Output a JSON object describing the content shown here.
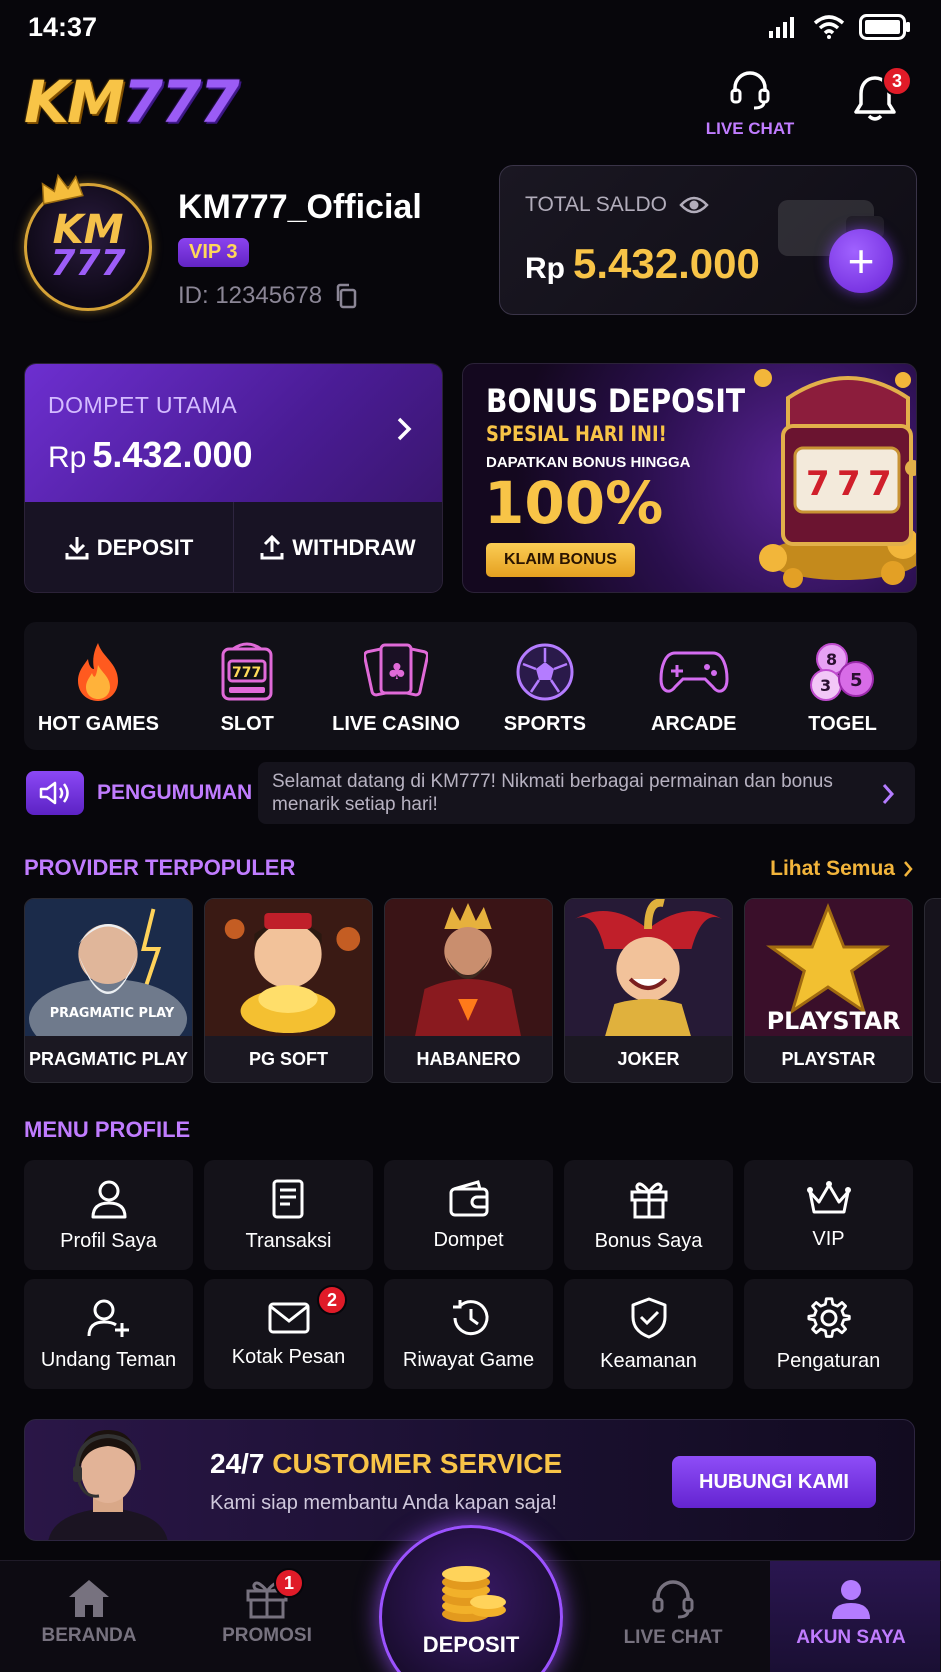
{
  "status_bar": {
    "time": "14:37"
  },
  "header": {
    "logo_km": "KM",
    "logo_num": "777",
    "live_chat_label": "LIVE CHAT",
    "notification_count": "3"
  },
  "profile": {
    "avatar_text_top": "KM",
    "avatar_text_bottom": "777",
    "username": "KM777_Official",
    "vip": "VIP 3",
    "id_text": "ID: 12345678"
  },
  "saldo": {
    "label": "TOTAL SALDO",
    "currency": "Rp",
    "amount": "5.432.000",
    "add_label": "+"
  },
  "wallet": {
    "title": "DOMPET UTAMA",
    "currency": "Rp",
    "amount": "5.432.000",
    "deposit_label": "DEPOSIT",
    "withdraw_label": "WITHDRAW"
  },
  "bonus_banner": {
    "title": "BONUS DEPOSIT",
    "subtitle": "SPESIAL HARI INI!",
    "caption": "DAPATKAN BONUS HINGGA",
    "percent": "100%",
    "button": "KLAIM BONUS"
  },
  "categories": [
    {
      "label": "HOT GAMES",
      "icon": "fire-icon"
    },
    {
      "label": "SLOT",
      "icon": "slot-machine-icon"
    },
    {
      "label": "LIVE CASINO",
      "icon": "cards-icon"
    },
    {
      "label": "SPORTS",
      "icon": "soccer-ball-icon"
    },
    {
      "label": "ARCADE",
      "icon": "gamepad-icon"
    },
    {
      "label": "TOGEL",
      "icon": "lottery-balls-icon"
    }
  ],
  "lottery_balls": [
    "8",
    "3",
    "5"
  ],
  "announcement": {
    "title": "PENGUMUMAN",
    "text": "Selamat datang di KM777! Nikmati berbagai permainan dan bonus menarik setiap hari!"
  },
  "providers_section": {
    "title": "PROVIDER TERPOPULER",
    "see_all": "Lihat Semua",
    "items": [
      {
        "label": "PRAGMATIC PLAY",
        "art_text": "PRAGMATIC PLAY"
      },
      {
        "label": "PG SOFT"
      },
      {
        "label": "HABANERO"
      },
      {
        "label": "JOKER"
      },
      {
        "label": "PLAYSTAR",
        "art_text": "PLAYSTAR"
      }
    ]
  },
  "menu_section": {
    "title": "MENU PROFILE",
    "items": [
      {
        "label": "Profil Saya",
        "icon": "user-icon"
      },
      {
        "label": "Transaksi",
        "icon": "receipt-icon"
      },
      {
        "label": "Dompet",
        "icon": "wallet-icon"
      },
      {
        "label": "Bonus Saya",
        "icon": "gift-icon"
      },
      {
        "label": "VIP",
        "icon": "crown-icon"
      },
      {
        "label": "Undang Teman",
        "icon": "user-plus-icon"
      },
      {
        "label": "Kotak Pesan",
        "icon": "mail-icon",
        "badge": "2"
      },
      {
        "label": "Riwayat Game",
        "icon": "history-icon"
      },
      {
        "label": "Keamanan",
        "icon": "shield-icon"
      },
      {
        "label": "Pengaturan",
        "icon": "gear-icon"
      }
    ]
  },
  "cs_banner": {
    "title_white": "24/7 ",
    "title_gold": "CUSTOMER SERVICE",
    "subtitle": "Kami siap membantu Anda kapan saja!",
    "button": "HUBUNGI KAMI"
  },
  "bottom_nav": {
    "home": "BERANDA",
    "promo": "PROMOSI",
    "promo_badge": "1",
    "deposit": "DEPOSIT",
    "live_chat": "LIVE CHAT",
    "account": "AKUN SAYA"
  },
  "colors": {
    "accent_purple": "#9b52ff",
    "gold": "#f8c447",
    "badge_red": "#e01b28",
    "background": "#07060b"
  }
}
